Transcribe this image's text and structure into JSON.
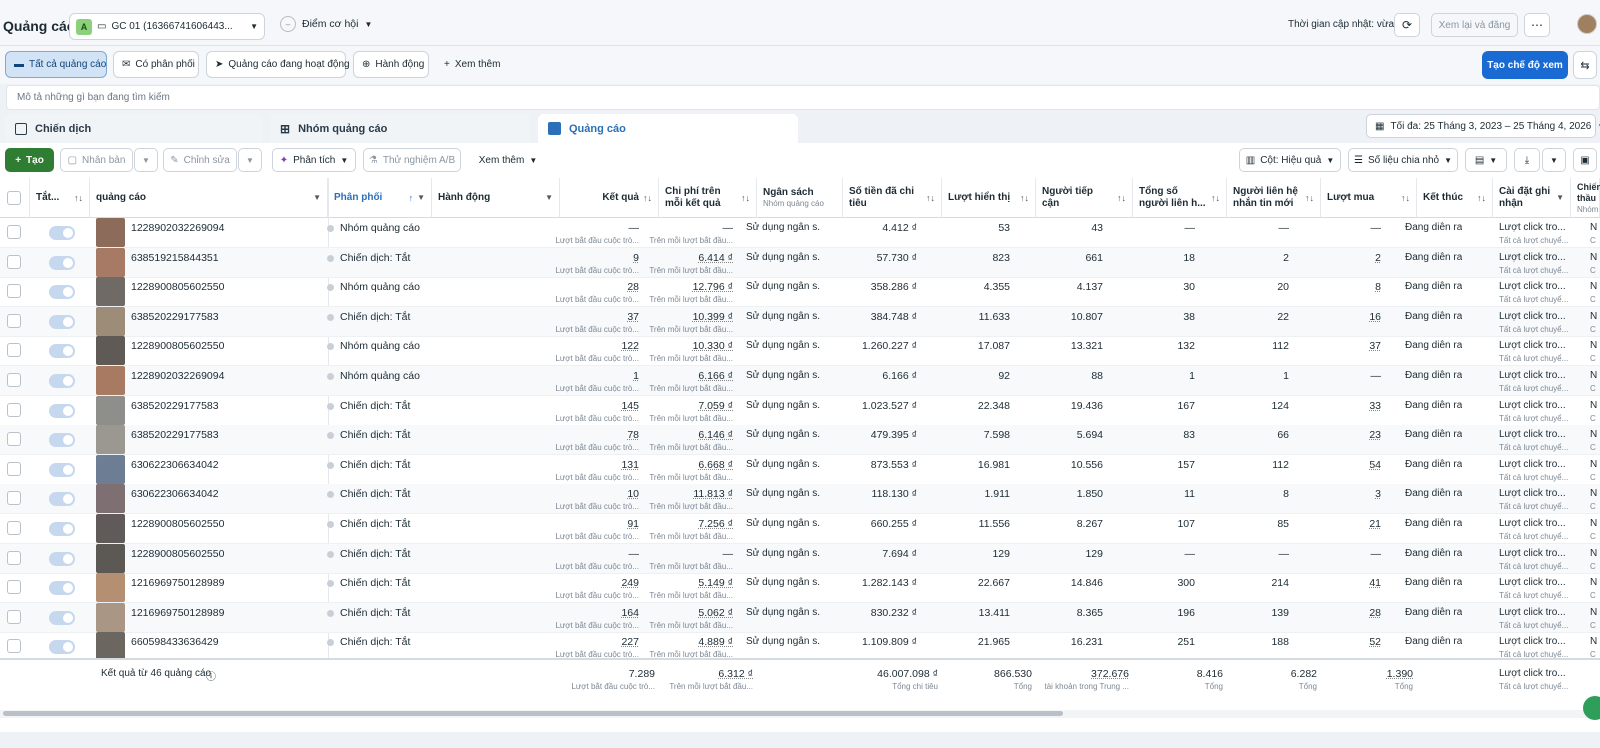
{
  "header": {
    "title": "Quảng cáo",
    "account_badge": "A",
    "account_name": "GC 01 (16366741606443...",
    "opportunity_label": "Điểm cơ hội",
    "update_text": "Thời gian cập nhật: vừa xong",
    "review_label": "Xem lại và đăng"
  },
  "filters": {
    "all_ads": "Tất cả quảng cáo",
    "has_delivery": "Có phân phối",
    "active_ads": "Quảng cáo đang hoạt động",
    "actions": "Hành động",
    "see_more": "Xem thêm",
    "create_view": "Tạo chế độ xem"
  },
  "search": {
    "placeholder": "Mô tả những gì bạn đang tìm kiếm"
  },
  "tabs": {
    "campaigns": "Chiến dịch",
    "adsets": "Nhóm quảng cáo",
    "ads": "Quảng cáo"
  },
  "date_range": "Tối đa: 25 Tháng 3, 2023 – 25 Tháng 4, 2026",
  "toolbar": {
    "create": "Tạo",
    "duplicate": "Nhân bản",
    "edit": "Chỉnh sửa",
    "analyze": "Phân tích",
    "ab_test": "Thử nghiệm A/B",
    "see_more": "Xem thêm",
    "columns": "Cột: Hiệu quả",
    "breakdown": "Số liệu chia nhỏ"
  },
  "columns": {
    "onoff": "Tắt...",
    "ad": "quảng cáo",
    "delivery": "Phân phối",
    "actions": "Hành động",
    "results": "Kết quả",
    "cost_per_result": "Chi phí trên mỗi kết quả",
    "budget": "Ngân sách",
    "budget_sub": "Nhóm quảng cáo",
    "spent": "Số tiền đã chi tiêu",
    "impressions": "Lượt hiển thị",
    "reach": "Người tiếp cận",
    "total_contacts": "Tổng số người liên h...",
    "new_contacts": "Người liên hệ nhắn tin mới",
    "purchases": "Lượt mua",
    "ends": "Kết thúc",
    "attribution": "Cài đặt ghi nhận",
    "bid": "Chiến thầu",
    "bid_sub": "Nhóm"
  },
  "row_subtexts": {
    "results": "Lượt bắt đầu cuộc trò...",
    "cost": "Trên mỗi lượt bắt đầu...",
    "budget": "Sử dụng ngân s...",
    "ends": "Đang diễn ra",
    "attribution": "Lượt click tro...",
    "attribution_sub": "Tất cả lượt chuyể...",
    "bid": "N",
    "bid_sub": "C"
  },
  "rows": [
    {
      "id": "1228902032269094",
      "delivery": "Nhóm quảng cáo đã",
      "results": "—",
      "cost": "—",
      "spent": "4.412 ₫",
      "impr": "53",
      "reach": "43",
      "total": "—",
      "newc": "—",
      "purch": "—"
    },
    {
      "id": "638519215844351",
      "delivery": "Chiến dịch: Tắt",
      "results": "9",
      "cost": "6.414 ₫",
      "spent": "57.730 ₫",
      "impr": "823",
      "reach": "661",
      "total": "18",
      "newc": "2",
      "purch": "2"
    },
    {
      "id": "1228900805602550",
      "delivery": "Nhóm quảng cáo đã",
      "results": "28",
      "cost": "12.796 ₫",
      "spent": "358.286 ₫",
      "impr": "4.355",
      "reach": "4.137",
      "total": "30",
      "newc": "20",
      "purch": "8"
    },
    {
      "id": "638520229177583",
      "delivery": "Chiến dịch: Tắt",
      "results": "37",
      "cost": "10.399 ₫",
      "spent": "384.748 ₫",
      "impr": "11.633",
      "reach": "10.807",
      "total": "38",
      "newc": "22",
      "purch": "16"
    },
    {
      "id": "1228900805602550",
      "delivery": "Nhóm quảng cáo đã",
      "results": "122",
      "cost": "10.330 ₫",
      "spent": "1.260.227 ₫",
      "impr": "17.087",
      "reach": "13.321",
      "total": "132",
      "newc": "112",
      "purch": "37"
    },
    {
      "id": "1228902032269094",
      "delivery": "Nhóm quảng cáo đã",
      "results": "1",
      "cost": "6.166 ₫",
      "spent": "6.166 ₫",
      "impr": "92",
      "reach": "88",
      "total": "1",
      "newc": "1",
      "purch": "—"
    },
    {
      "id": "638520229177583",
      "delivery": "Chiến dịch: Tắt",
      "results": "145",
      "cost": "7.059 ₫",
      "spent": "1.023.527 ₫",
      "impr": "22.348",
      "reach": "19.436",
      "total": "167",
      "newc": "124",
      "purch": "33"
    },
    {
      "id": "638520229177583",
      "delivery": "Chiến dịch: Tắt",
      "results": "78",
      "cost": "6.146 ₫",
      "spent": "479.395 ₫",
      "impr": "7.598",
      "reach": "5.694",
      "total": "83",
      "newc": "66",
      "purch": "23"
    },
    {
      "id": "630622306634042",
      "delivery": "Chiến dịch: Tắt",
      "results": "131",
      "cost": "6.668 ₫",
      "spent": "873.553 ₫",
      "impr": "16.981",
      "reach": "10.556",
      "total": "157",
      "newc": "112",
      "purch": "54"
    },
    {
      "id": "630622306634042",
      "delivery": "Chiến dịch: Tắt",
      "results": "10",
      "cost": "11.813 ₫",
      "spent": "118.130 ₫",
      "impr": "1.911",
      "reach": "1.850",
      "total": "11",
      "newc": "8",
      "purch": "3"
    },
    {
      "id": "1228900805602550",
      "delivery": "Chiến dịch: Tắt",
      "results": "91",
      "cost": "7.256 ₫",
      "spent": "660.255 ₫",
      "impr": "11.556",
      "reach": "8.267",
      "total": "107",
      "newc": "85",
      "purch": "21"
    },
    {
      "id": "1228900805602550",
      "delivery": "Chiến dịch: Tắt",
      "results": "—",
      "cost": "—",
      "spent": "7.694 ₫",
      "impr": "129",
      "reach": "129",
      "total": "—",
      "newc": "—",
      "purch": "—"
    },
    {
      "id": "1216969750128989",
      "delivery": "Chiến dịch: Tắt",
      "results": "249",
      "cost": "5.149 ₫",
      "spent": "1.282.143 ₫",
      "impr": "22.667",
      "reach": "14.846",
      "total": "300",
      "newc": "214",
      "purch": "41"
    },
    {
      "id": "1216969750128989",
      "delivery": "Chiến dịch: Tắt",
      "results": "164",
      "cost": "5.062 ₫",
      "spent": "830.232 ₫",
      "impr": "13.411",
      "reach": "8.365",
      "total": "196",
      "newc": "139",
      "purch": "28"
    },
    {
      "id": "660598433636429",
      "delivery": "Chiến dịch: Tắt",
      "results": "227",
      "cost": "4.889 ₫",
      "spent": "1.109.809 ₫",
      "impr": "21.965",
      "reach": "16.231",
      "total": "251",
      "newc": "188",
      "purch": "52"
    }
  ],
  "totals": {
    "label": "Kết quả từ 46 quảng cáo",
    "results": "7.289",
    "results_sub": "Lượt bắt đầu cuộc trò...",
    "cost": "6.312 ₫",
    "cost_sub": "Trên mỗi lượt bắt đầu...",
    "spent": "46.007.098 ₫",
    "spent_sub": "Tổng chi tiêu",
    "impr": "866.530",
    "impr_sub": "Tổng",
    "reach": "372.676",
    "reach_sub": "tài khoản trong Trung ...",
    "total": "8.416",
    "total_sub": "Tổng",
    "newc": "6.282",
    "newc_sub": "Tổng",
    "purch": "1.390",
    "purch_sub": "Tổng",
    "attr": "Lượt click tro...",
    "attr_sub": "Tất cả lượt chuyể..."
  },
  "colors": {
    "accent": "#1a6ad3",
    "create_green": "#2e7d32",
    "active_tab": "#2b6fb8"
  }
}
